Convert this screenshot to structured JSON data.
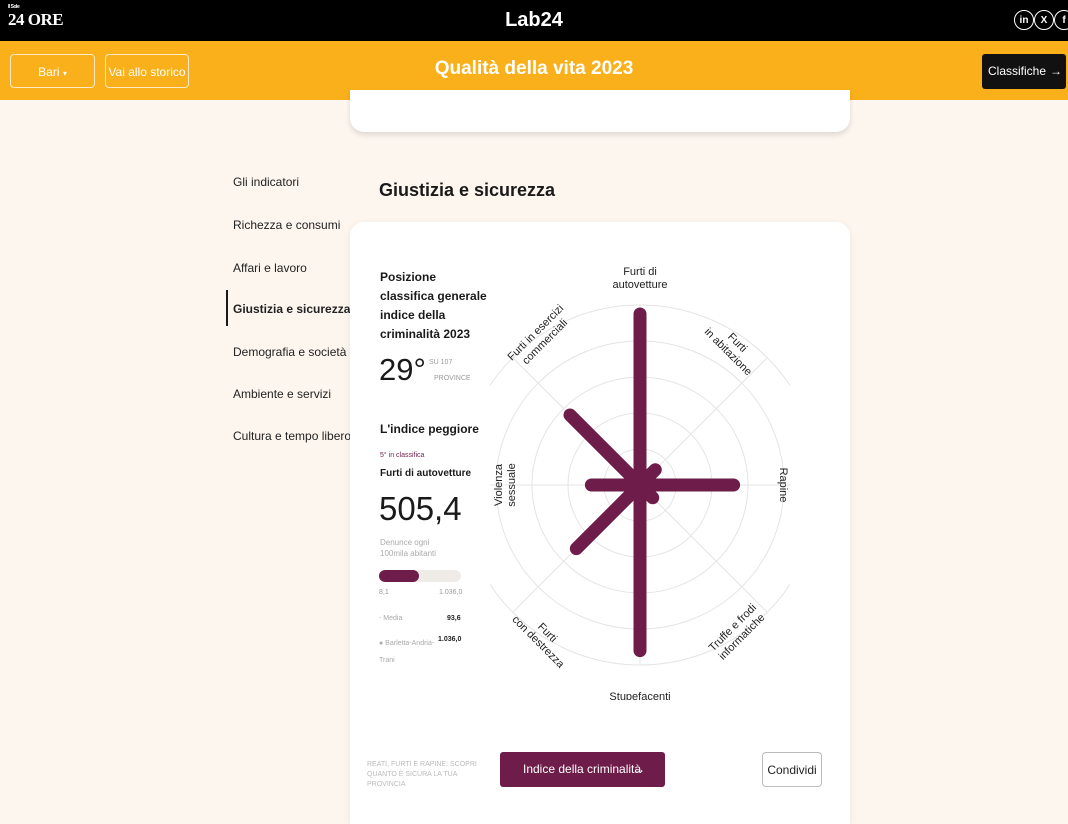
{
  "topbar": {
    "logo": "24 ORE",
    "logo_small": "Il Sole",
    "brand": "Lab24",
    "social": [
      "in",
      "X",
      "f"
    ]
  },
  "nav": {
    "city": "Bari",
    "history": "Vai allo storico",
    "title": "Qualità della vita 2023",
    "rankings": "Classifiche",
    "rankings_arrow": "→"
  },
  "sidebar": {
    "items": [
      "Gli indicatori",
      "Richezza e consumi",
      "Affari e lavoro",
      "Giustizia e sicurezza",
      "Demografia e società",
      "Ambiente e servizi",
      "Cultura e tempo libero"
    ],
    "active": 3
  },
  "section": {
    "title": "Giustizia e sicurezza"
  },
  "card": {
    "position_title": "Posizione classifica generale indice della criminalità 2023",
    "rank": "29°",
    "rank_of": "SU 107",
    "rank_unit": "PROVINCE",
    "worst_title": "L'indice peggiore",
    "worst_rank": "5° in classifica",
    "worst_name": "Furti di autovetture",
    "worst_value": "505,4",
    "worst_unit": "Denunce ogni 100mila abitanti",
    "bar_fill_fraction": 0.49,
    "bar_min": "8,1",
    "bar_max": "1.036,0",
    "legend": [
      {
        "label": "- Media",
        "value": "93,6"
      },
      {
        "label": "● Barletta-Andria-Trani",
        "value": "1.036,0"
      }
    ],
    "footer_note": "REATI, FURTI E RAPINE: SCOPRI QUANTO È SICURA LA TUA PROVINCIA",
    "crime_button": "Indice della criminalità",
    "crime_arrow": "→",
    "share_button": "Condividi"
  },
  "chart_data": {
    "type": "radar",
    "axes": [
      "Furti di autovetture",
      "Furti in abitazione",
      "Rapine",
      "Truffe e frodi informatiche",
      "Stupefacenti",
      "Furti con destrezza",
      "Violenza sessuale",
      "Furti in esercizi commerciali"
    ],
    "values": [
      0.95,
      0.12,
      0.52,
      0.1,
      0.92,
      0.5,
      0.27,
      0.55
    ],
    "color": "#6e1d4a"
  }
}
